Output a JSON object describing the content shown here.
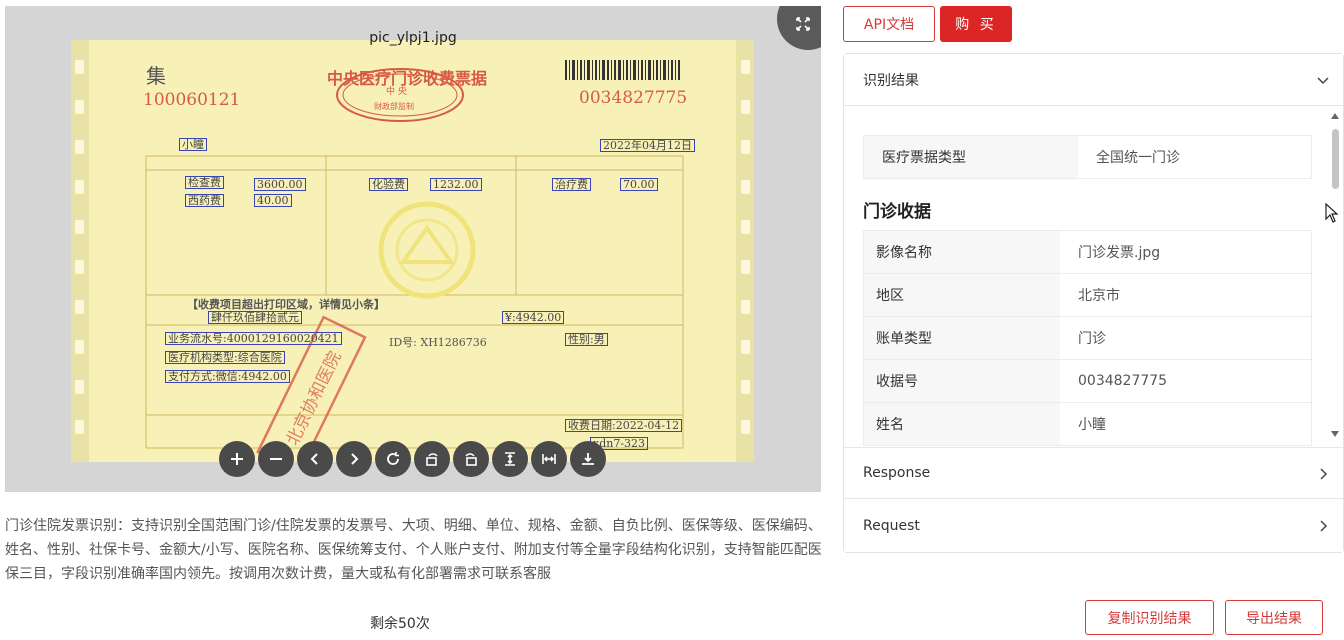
{
  "viewer": {
    "file_name": "pic_ylpj1.jpg",
    "receipt": {
      "title": "中央医疗门诊收费票据",
      "left_number": "100060121",
      "right_number": "0034827775",
      "corner_mark": "集",
      "seal_top": "中 央",
      "seal_bottom": "财政部监制",
      "payer": "小瞳",
      "date": "2022年04月12日",
      "items": [
        {
          "name": "检查费",
          "amount": "3600.00"
        },
        {
          "name": "化验费",
          "amount": "1232.00"
        },
        {
          "name": "治疗费",
          "amount": "70.00"
        },
        {
          "name": "西药费",
          "amount": "40.00"
        }
      ],
      "overflow_note": "【收费项目超出打印区域，详情见小条】",
      "total_words": "肆仟玖佰肆拾贰元",
      "total_small": "¥:4942.00",
      "serial": "业务流水号:4000129160020421",
      "id_line": "ID号: XH1286736",
      "gender": "性别:男",
      "org_type": "医疗机构类型:综合医院",
      "payment": "支付方式:微信:4942.00",
      "pay_date": "收费日期:2022-04-12",
      "receiver": "xdn7-323",
      "stamp": "北京协和医院"
    },
    "toolbar": [
      "zoom-in",
      "zoom-out",
      "prev",
      "next",
      "reset",
      "rotate-left",
      "rotate-right",
      "flip-vertical",
      "flip-horizontal",
      "download"
    ]
  },
  "description": "门诊住院发票识别：支持识别全国范围门诊/住院发票的发票号、大项、明细、单位、规格、金额、自负比例、医保等级、医保编码、姓名、性别、社保卡号、金额大/小写、医院名称、医保统筹支付、个人账户支付、附加支付等全量字段结构化识别，支持智能匹配医保三目，字段识别准确率国内领先。按调用次数计费，量大或私有化部署需求可联系客服",
  "remaining": "剩余50次",
  "buttons": {
    "api_doc": "API文档",
    "buy": "购 买",
    "copy_result": "复制识别结果",
    "export_result": "导出结果"
  },
  "panel": {
    "result_title": "识别结果",
    "invoice_type": {
      "key": "医疗票据类型",
      "value": "全国统一门诊"
    },
    "section_title": "门诊收据",
    "fields": [
      {
        "key": "影像名称",
        "value": "门诊发票.jpg"
      },
      {
        "key": "地区",
        "value": "北京市"
      },
      {
        "key": "账单类型",
        "value": "门诊"
      },
      {
        "key": "收据号",
        "value": "0034827775"
      },
      {
        "key": "姓名",
        "value": "小瞳"
      }
    ],
    "response_title": "Response",
    "request_title": "Request"
  }
}
